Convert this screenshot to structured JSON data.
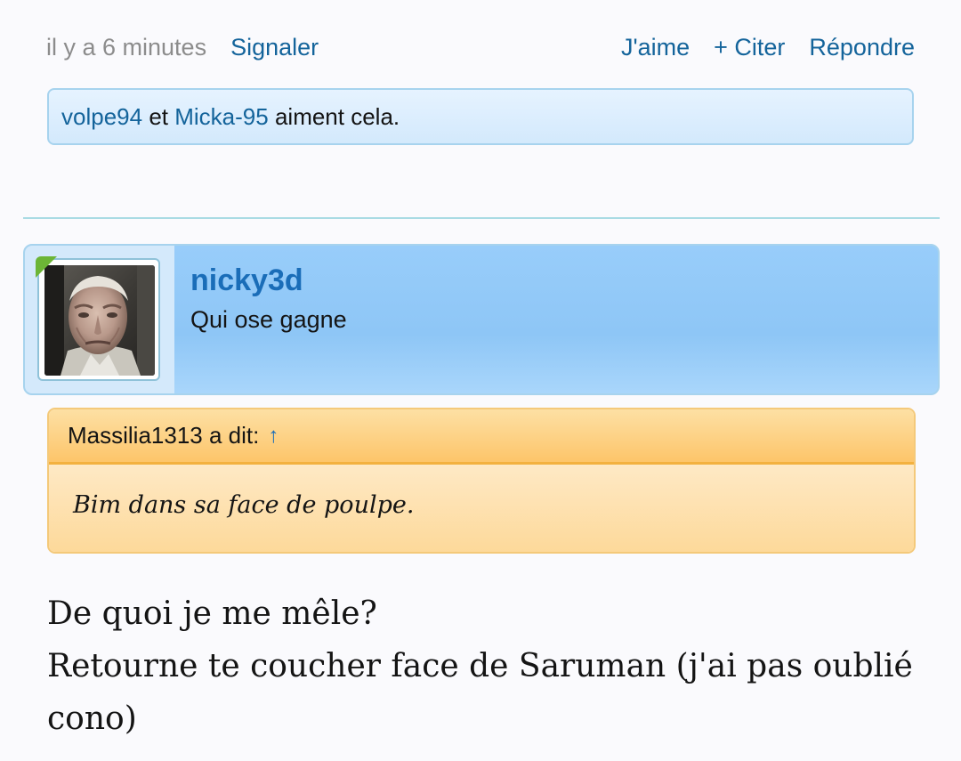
{
  "post_footer": {
    "time": "il y a 6 minutes",
    "report": "Signaler",
    "like": "J'aime",
    "quote": "+ Citer",
    "reply": "Répondre"
  },
  "likes": {
    "users": [
      "volpe94",
      "Micka-95"
    ],
    "connector": "et",
    "suffix": "aiment cela."
  },
  "user": {
    "name": "nicky3d",
    "title": "Qui ose gagne",
    "avatar_icon": "user-avatar-photo",
    "online_color": "#6cb536"
  },
  "quote": {
    "author_line": "Massilia1313 a dit:",
    "arrow": "↑",
    "text": "Bim dans sa face de poulpe."
  },
  "message": {
    "lines": [
      "De quoi je me mêle?",
      "Retourne te coucher face de Saruman (j'ai pas oublié cono)"
    ]
  },
  "colors": {
    "link": "#14649b",
    "username": "#1a6db8",
    "quote_border": "#f3b13f",
    "header_blue": "#98cdfa"
  }
}
